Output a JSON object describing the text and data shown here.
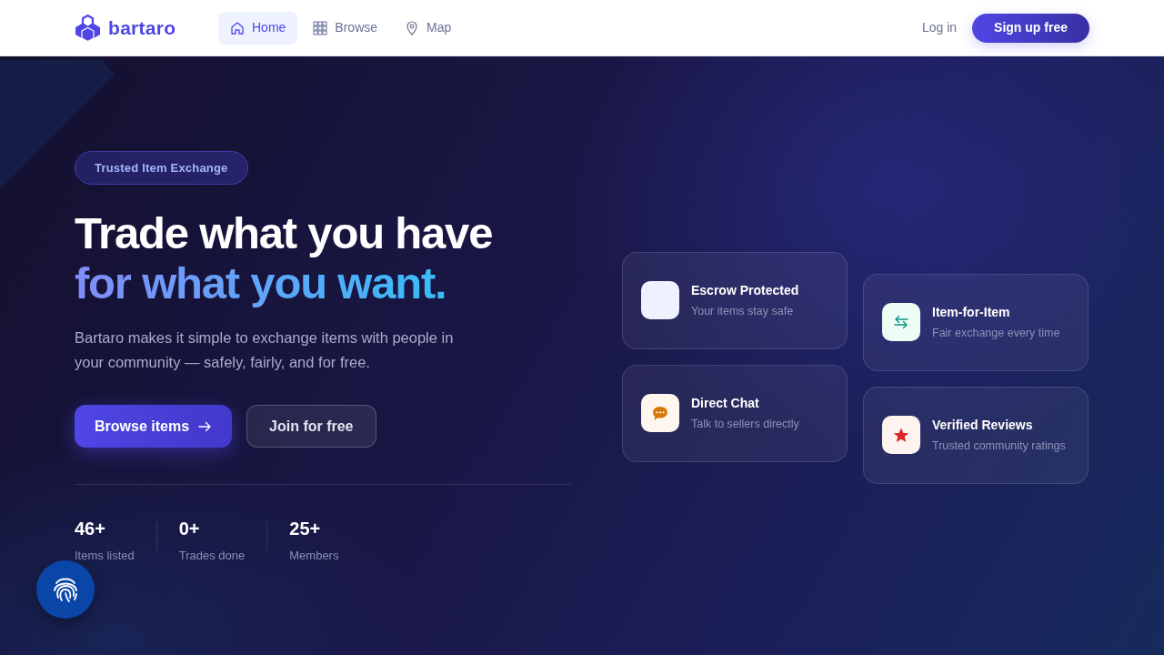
{
  "navbar": {
    "brand": "bartaro",
    "links": [
      {
        "label": "Home",
        "selected": true
      },
      {
        "label": "Browse",
        "selected": false
      },
      {
        "label": "Map",
        "selected": false
      }
    ],
    "login": "Log in",
    "signup": "Sign up free"
  },
  "hero": {
    "badge": "Trusted Item Exchange",
    "title": "Trade what you have",
    "title_highlight": "for what you want.",
    "description": "Bartaro makes it simple to exchange items with people in your community — safely, fairly, and for free.",
    "buttons": [
      {
        "label": "Browse items",
        "kind": "primary"
      },
      {
        "label": "Join for free",
        "kind": "secondary"
      }
    ],
    "stats": [
      {
        "value": "46+",
        "label": "Items listed"
      },
      {
        "value": "0+",
        "label": "Trades done"
      },
      {
        "value": "25+",
        "label": "Members"
      }
    ]
  },
  "features": [
    {
      "title": "Escrow Protected",
      "subtitle": "Your items stay safe",
      "color": "#eef2ff"
    },
    {
      "title": "Item-for-Item",
      "subtitle": "Fair exchange every time",
      "color": "#ecfdf5"
    },
    {
      "title": "Direct Chat",
      "subtitle": "Talk to sellers directly",
      "color": "#fff7ed"
    },
    {
      "title": "Verified Reviews",
      "subtitle": "Trusted community ratings",
      "color": "#fdf4f0"
    }
  ]
}
